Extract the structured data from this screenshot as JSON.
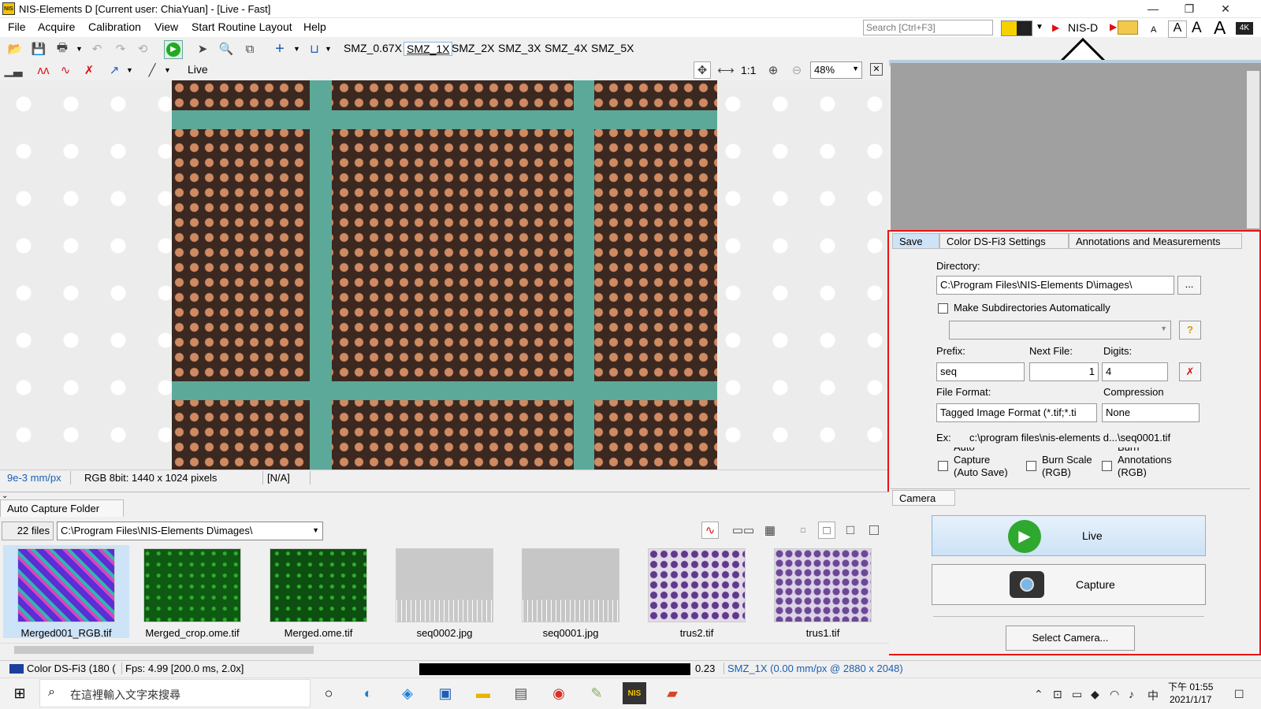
{
  "window": {
    "title": "NIS-Elements D [Current user: ChiaYuan]  - [Live - Fast]",
    "logo_text": "NIS",
    "minimize": "—",
    "maximize": "❐",
    "close": "✕"
  },
  "menu": [
    "File",
    "Acquire",
    "Calibration",
    "View",
    "Start Routine Layout",
    "Help"
  ],
  "search": {
    "placeholder": "Search [Ctrl+F3]"
  },
  "layout_label": "NIS-D",
  "font_sizes": [
    "A",
    "A",
    "A",
    "A"
  ],
  "badge_4k": "4K",
  "objectives": [
    "SMZ_0.67X",
    "SMZ_1X",
    "SMZ_2X",
    "SMZ_3X",
    "SMZ_4X",
    "SMZ_5X"
  ],
  "viewer": {
    "mode_label": "Live",
    "one_to_one": "1:1",
    "zoom": "48%"
  },
  "viewer_status": {
    "calibration": "9e-3 mm/px",
    "image_info": "RGB 8bit: 1440 x 1024 pixels",
    "value": "[N/A]"
  },
  "auto_capture": {
    "tab_label": "Auto Capture Folder",
    "file_count": "22 files",
    "path": "C:\\Program Files\\NIS-Elements D\\images\\",
    "thumbnails": [
      {
        "name": "Merged001_RGB.tif",
        "color": "#4b3fd0"
      },
      {
        "name": "Merged_crop.ome.tif",
        "color": "#0f5a12"
      },
      {
        "name": "Merged.ome.tif",
        "color": "#0d4f10"
      },
      {
        "name": "seq0002.jpg",
        "color": "#c9c9c9"
      },
      {
        "name": "seq0001.jpg",
        "color": "#c6c6c6"
      },
      {
        "name": "trus2.tif",
        "color": "#d5c9dc"
      },
      {
        "name": "trus1.tif",
        "color": "#cfc3d8"
      }
    ]
  },
  "status_bar": {
    "camera": "Color DS-Fi3 (180 (",
    "fps": "Fps: 4.99 [200.0 ms, 2.0x]",
    "value": "0.23",
    "objective_info": "SMZ_1X (0.00 mm/px @ 2880 x 2048)"
  },
  "save_panel": {
    "tabs": [
      "Save",
      "Color DS-Fi3 Settings",
      "Annotations and Measurements"
    ],
    "directory_label": "Directory:",
    "directory_value": "C:\\Program Files\\NIS-Elements D\\images\\",
    "browse": "...",
    "make_subdirs": "Make Subdirectories Automatically",
    "help_icon": "?",
    "prefix_label": "Prefix:",
    "prefix_value": "seq",
    "next_file_label": "Next File:",
    "next_file_value": "1",
    "digits_label": "Digits:",
    "digits_value": "4",
    "file_format_label": "File Format:",
    "file_format_value": "Tagged Image Format (*.tif;*.ti",
    "compression_label": "Compression",
    "compression_value": "None",
    "example_label": "Ex:",
    "example_value": "c:\\program files\\nis-elements d...\\seq0001.tif",
    "auto_capture_line1": "Auto",
    "auto_capture_line2": "Capture",
    "auto_capture_line3": "(Auto Save)",
    "burn_scale_line1": "Burn Scale",
    "burn_scale_line2": "(RGB)",
    "burn_annotations_line1": "Burn",
    "burn_annotations_line2": "Annotations",
    "burn_annotations_line3": "(RGB)"
  },
  "camera_panel": {
    "tab": "Camera",
    "live": "Live",
    "capture": "Capture",
    "select_camera": "Select Camera..."
  },
  "taskbar": {
    "search_placeholder": "在這裡輸入文字來搜尋",
    "time": "下午 01:55",
    "date": "2021/1/17",
    "ime": "中"
  }
}
